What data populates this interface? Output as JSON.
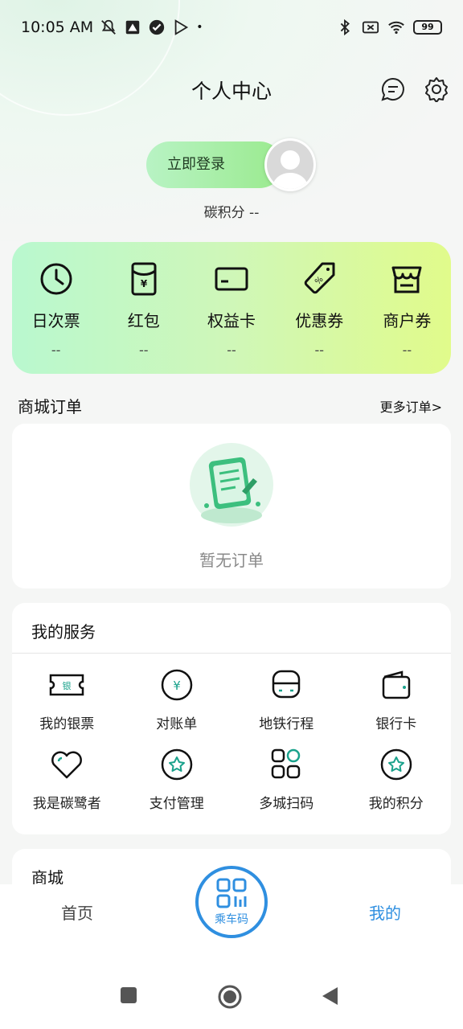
{
  "status_bar": {
    "time": "10:05 AM",
    "battery": "99"
  },
  "header": {
    "title": "个人中心"
  },
  "login": {
    "button_label": "立即登录",
    "carbon_points": "碳积分 --"
  },
  "benefits": [
    {
      "label": "日次票",
      "value": "--",
      "icon": "clock-icon"
    },
    {
      "label": "红包",
      "value": "--",
      "icon": "red-envelope-icon"
    },
    {
      "label": "权益卡",
      "value": "--",
      "icon": "card-icon"
    },
    {
      "label": "优惠券",
      "value": "--",
      "icon": "coupon-tag-icon"
    },
    {
      "label": "商户券",
      "value": "--",
      "icon": "store-icon"
    }
  ],
  "orders": {
    "title": "商城订单",
    "more": "更多订单>",
    "empty_text": "暂无订单"
  },
  "services": {
    "title": "我的服务",
    "items": [
      {
        "label": "我的银票",
        "icon": "ticket-icon"
      },
      {
        "label": "对账单",
        "icon": "yuan-circle-icon"
      },
      {
        "label": "地铁行程",
        "icon": "metro-icon"
      },
      {
        "label": "银行卡",
        "icon": "wallet-icon"
      },
      {
        "label": "我是碳鹭者",
        "icon": "heart-icon"
      },
      {
        "label": "支付管理",
        "icon": "star-circle-icon"
      },
      {
        "label": "多城扫码",
        "icon": "apps-grid-icon"
      },
      {
        "label": "我的积分",
        "icon": "star-circle-icon"
      }
    ]
  },
  "mall": {
    "title": "商城"
  },
  "tabbar": {
    "home": "首页",
    "qr": "乘车码",
    "mine": "我的"
  },
  "colors": {
    "accent": "#2f8fe0",
    "green": "#2bb673",
    "benefit_gradient_start": "#b9f8cf",
    "benefit_gradient_end": "#e1fb8b"
  }
}
